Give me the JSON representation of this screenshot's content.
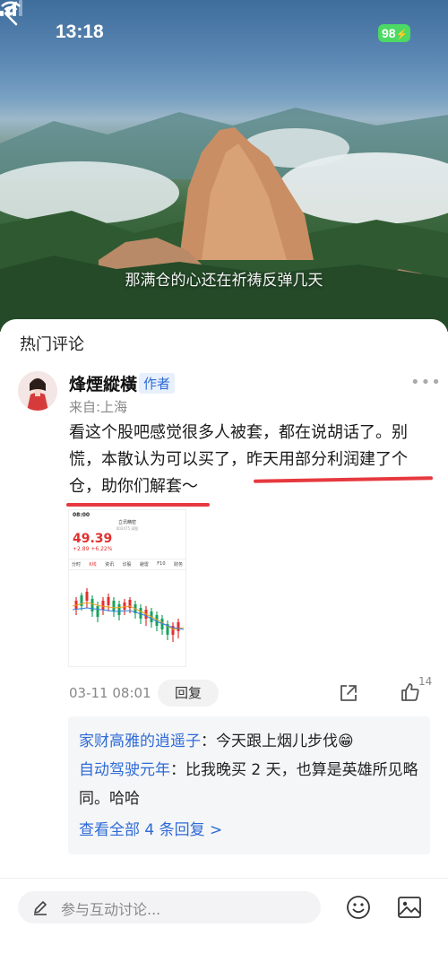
{
  "status_bar": {
    "time": "13:18",
    "battery": "98"
  },
  "video": {
    "caption": "那满仓的心还在祈祷反弹几天"
  },
  "comments_section": {
    "title": "热门评论",
    "comment": {
      "username": "烽煙縱橫",
      "author_tag": "作者",
      "location": "来自:上海",
      "text": "看这个股吧感觉很多人被套，都在说胡话了。别慌，本散认为可以买了，昨天用部分利润建了个仓，助你们解套～",
      "timestamp": "03-11 08:01",
      "reply_label": "回复",
      "like_count": "14",
      "screenshot": {
        "time": "08:00",
        "stock_name": "立讯精密",
        "stock_code": "002475 深股",
        "price": "49.39",
        "change": "+2.89",
        "change_pct": "+6.22%",
        "tabs": [
          "分时",
          "K线",
          "资讯",
          "诊股",
          "避雷",
          "F10",
          "财务"
        ]
      },
      "replies": [
        {
          "name": "家财高雅的逍遥子",
          "text": "：今天跟上烟儿步伐😁"
        },
        {
          "name": "自动驾驶元年",
          "text": "：比我晚买 2 天，也算是英雄所见略同。哈哈"
        }
      ],
      "view_all": "查看全部 4 条回复 >"
    }
  },
  "bottom_bar": {
    "placeholder": "参与互动讨论..."
  },
  "colors": {
    "accent_blue": "#2e6bd6",
    "underline_red": "#e6393f",
    "battery_green": "#4cd964"
  }
}
